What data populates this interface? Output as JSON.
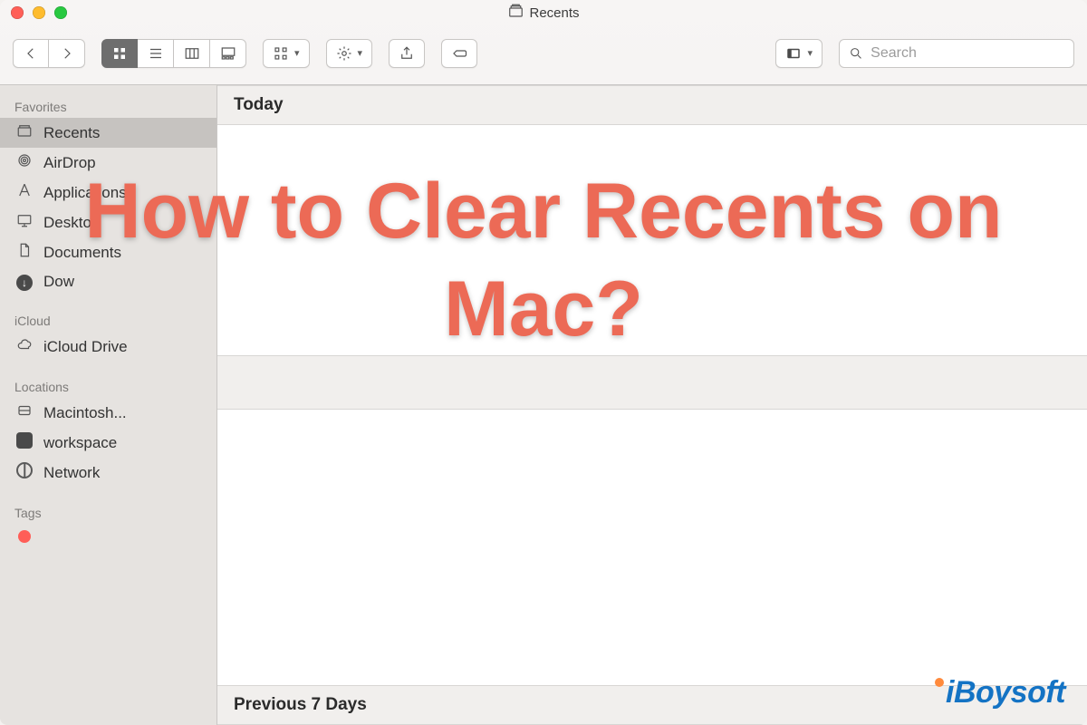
{
  "window": {
    "title": "Recents"
  },
  "toolbar": {
    "search_placeholder": "Search"
  },
  "sidebar": {
    "sections": {
      "favorites": "Favorites",
      "icloud": "iCloud",
      "locations": "Locations",
      "tags": "Tags"
    },
    "items": {
      "recents": "Recents",
      "airdrop": "AirDrop",
      "applications": "Applications",
      "desktop": "Desktop",
      "documents": "Documents",
      "downloads": "Dow",
      "icloud_drive": "iCloud Drive",
      "macintosh": "Macintosh...",
      "workspace": "workspace",
      "network": "Network"
    }
  },
  "main": {
    "group_today": "Today",
    "group_prev7": "Previous 7 Days"
  },
  "overlay": {
    "headline": "How to Clear Recents on Mac?"
  },
  "brand": "iBoysoft"
}
